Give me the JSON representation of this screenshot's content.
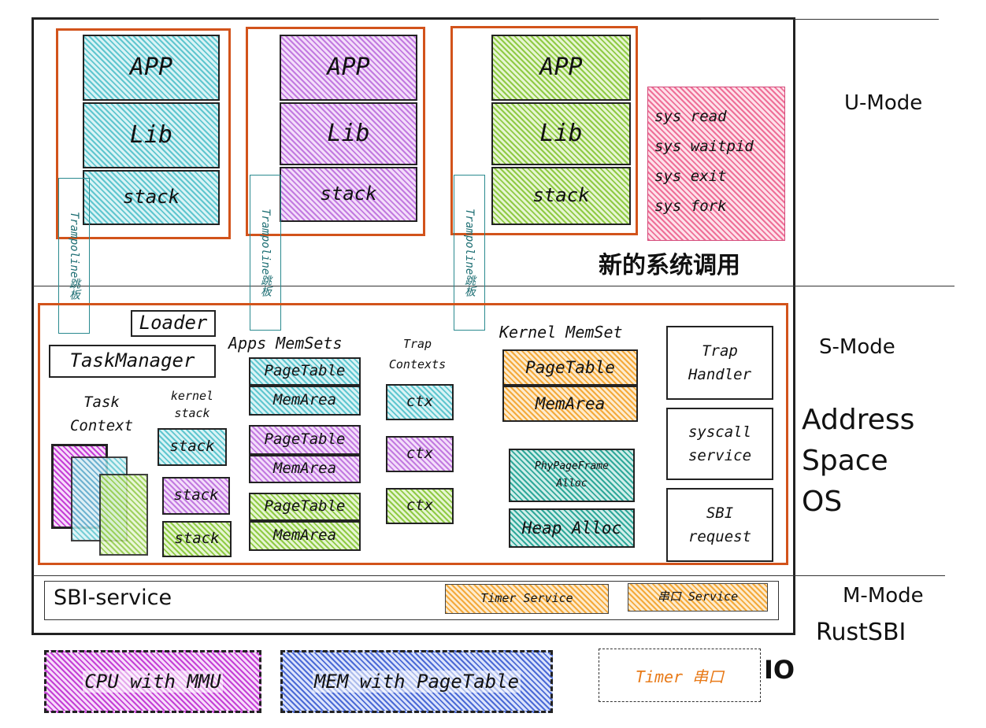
{
  "user_mode": {
    "apps": [
      {
        "app": "APP",
        "lib": "Lib",
        "stack": "stack",
        "trampoline": "Trampoline跳板"
      },
      {
        "app": "APP",
        "lib": "Lib",
        "stack": "stack",
        "trampoline": "Trampoline跳板"
      },
      {
        "app": "APP",
        "lib": "Lib",
        "stack": "stack",
        "trampoline": "Trampoline跳板"
      }
    ],
    "syscalls": [
      "sys read",
      "sys waitpid",
      "sys exit",
      "sys fork"
    ],
    "syscalls_caption": "新的系统调用"
  },
  "side_labels": {
    "u_mode": "U-Mode",
    "s_mode": "S-Mode",
    "address_space_os": [
      "Address",
      "Space",
      "OS"
    ],
    "m_mode": "M-Mode",
    "rustsbi": "RustSBI",
    "io": "IO"
  },
  "supervisor": {
    "loader": "Loader",
    "task_manager": "TaskManager",
    "task_context": [
      "Task",
      "Context"
    ],
    "kernel_stack": [
      "kernel",
      "stack"
    ],
    "kernel_stacks": [
      "stack",
      "stack",
      "stack"
    ],
    "apps_memsets": {
      "title": "Apps MemSets",
      "sets": [
        {
          "page_table": "PageTable",
          "mem_area": "MemArea"
        },
        {
          "page_table": "PageTable",
          "mem_area": "MemArea"
        },
        {
          "page_table": "PageTable",
          "mem_area": "MemArea"
        }
      ]
    },
    "trap_contexts": {
      "title": [
        "Trap",
        "Contexts"
      ],
      "items": [
        "ctx",
        "ctx",
        "ctx"
      ]
    },
    "kernel_memset": {
      "title": "Kernel MemSet",
      "page_table": "PageTable",
      "mem_area": "MemArea",
      "phy_alloc": [
        "PhyPageFrame",
        "Alloc"
      ],
      "heap_alloc": "Heap Alloc"
    },
    "trap_handler": [
      "Trap",
      "Handler"
    ],
    "syscall_service": [
      "syscall",
      "service"
    ],
    "sbi_request": [
      "SBI",
      "request"
    ]
  },
  "machine": {
    "sbi_service": "SBI-service",
    "timer_service": "Timer Service",
    "serial_service": "串口 Service"
  },
  "hardware": {
    "cpu": "CPU with MMU",
    "mem": "MEM with PageTable",
    "io_devices": "Timer 串口"
  },
  "colors": {
    "orange_border": "#d2531b",
    "cyan": "#5fc6cf",
    "purple": "#c27ae0",
    "green": "#8fca44",
    "pink": "#ef6f97",
    "orange_fill": "#f4a93a",
    "teal": "#2fa89a",
    "blue": "#4b6ad6",
    "io_text": "#e87a18"
  }
}
